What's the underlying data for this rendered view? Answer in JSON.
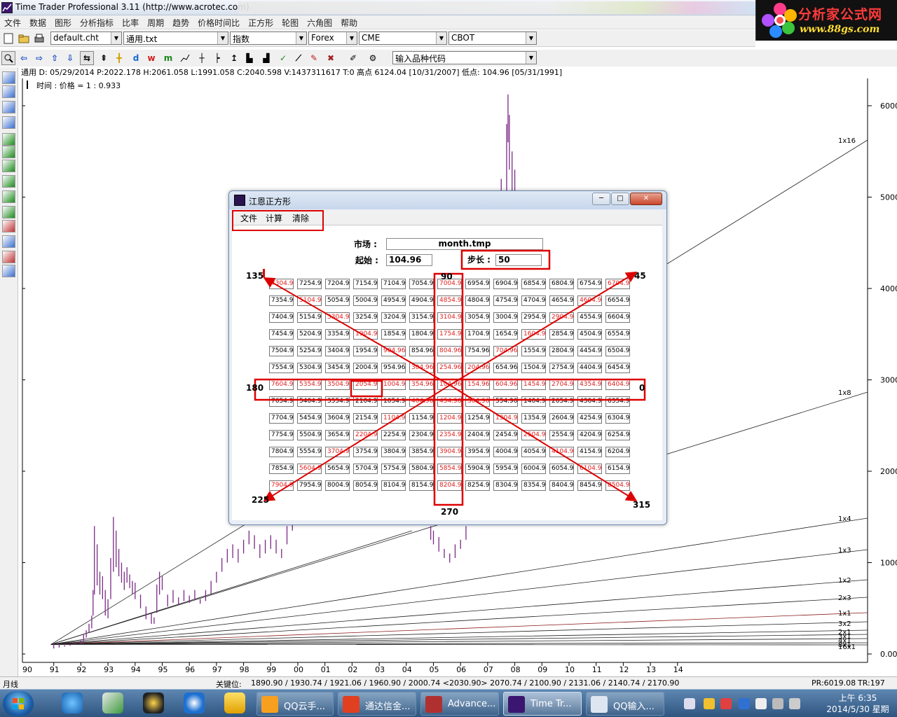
{
  "window": {
    "title": "Time Trader Professional 3.11 (http://www.acrotec.com)"
  },
  "brand": {
    "line1": "分析家公式网",
    "line2": "www.88gs.com"
  },
  "menu": [
    "文件",
    "数据",
    "图形",
    "分析指标",
    "比率",
    "周期",
    "趋势",
    "价格时间比",
    "正方形",
    "轮图",
    "六角图",
    "帮助"
  ],
  "toolbar": {
    "chart_file": "default.cht",
    "template_file": "通用.txt",
    "type": "指数",
    "market1": "Forex",
    "market2": "CME",
    "market3": "CBOT",
    "symbol_input": "输入品种代码"
  },
  "infobar": {
    "text": "通用  D: 05/29/2014  P:2022.178  H:2061.058  L:1991.058  C:2040.598  V:1437311617  T:0      高点   6124.04 [10/31/2007]  低点:    104.96 [05/31/1991]",
    "sub": "时间 : 价格  = 1 :    0.933"
  },
  "chart": {
    "y_ticks": [
      {
        "v": 6000,
        "label": "6000"
      },
      {
        "v": 5000,
        "label": "5000"
      },
      {
        "v": 4000,
        "label": "4000"
      },
      {
        "v": 3000,
        "label": "3000"
      },
      {
        "v": 2000,
        "label": "2000"
      },
      {
        "v": 1000,
        "label": "1000"
      },
      {
        "v": 0,
        "label": "0.00"
      }
    ],
    "x_ticks": [
      "91",
      "92",
      "93",
      "94",
      "95",
      "96",
      "97",
      "98",
      "99",
      "00",
      "01",
      "02",
      "03",
      "04",
      "05",
      "06",
      "07",
      "08",
      "09",
      "10",
      "11",
      "12",
      "13",
      "14"
    ],
    "x_start_label": "90",
    "fan_labels": [
      "1x16",
      "1x8",
      "1x4",
      "1x3",
      "1x2",
      "2x3",
      "1x1",
      "3x2",
      "2x1",
      "3x1",
      "4x1",
      "8x1",
      "16x1"
    ],
    "bars": [
      [
        1991.0,
        120,
        60
      ],
      [
        1991.2,
        110,
        70
      ],
      [
        1991.4,
        95,
        80
      ],
      [
        1991.6,
        110,
        90
      ],
      [
        1991.8,
        130,
        100
      ],
      [
        1992.0,
        150,
        110
      ],
      [
        1992.1,
        210,
        140
      ],
      [
        1992.2,
        260,
        180
      ],
      [
        1992.3,
        330,
        230
      ],
      [
        1992.4,
        420,
        280
      ],
      [
        1992.45,
        700,
        420
      ],
      [
        1992.5,
        1400,
        650
      ],
      [
        1992.6,
        1200,
        750
      ],
      [
        1992.7,
        900,
        650
      ],
      [
        1992.8,
        850,
        600
      ],
      [
        1992.9,
        700,
        420
      ],
      [
        1993.0,
        600,
        390
      ],
      [
        1993.1,
        1050,
        600
      ],
      [
        1993.2,
        1500,
        900
      ],
      [
        1993.3,
        1350,
        950
      ],
      [
        1993.4,
        1150,
        850
      ],
      [
        1993.5,
        1000,
        780
      ],
      [
        1993.6,
        900,
        700
      ],
      [
        1993.7,
        950,
        780
      ],
      [
        1993.8,
        870,
        720
      ],
      [
        1993.9,
        800,
        650
      ],
      [
        1994.0,
        780,
        600
      ],
      [
        1994.2,
        650,
        500
      ],
      [
        1994.4,
        520,
        380
      ],
      [
        1994.6,
        450,
        330
      ],
      [
        1994.7,
        400,
        330
      ],
      [
        1994.8,
        760,
        450
      ],
      [
        1994.9,
        900,
        650
      ],
      [
        1995.0,
        850,
        700
      ],
      [
        1995.2,
        650,
        520
      ],
      [
        1995.4,
        700,
        560
      ],
      [
        1995.6,
        620,
        540
      ],
      [
        1995.8,
        700,
        580
      ],
      [
        1996.0,
        640,
        560
      ],
      [
        1996.2,
        700,
        600
      ],
      [
        1996.4,
        600,
        550
      ],
      [
        1996.6,
        700,
        580
      ],
      [
        1996.8,
        800,
        650
      ],
      [
        1997.0,
        900,
        780
      ],
      [
        1997.2,
        1050,
        900
      ],
      [
        1997.4,
        1150,
        1000
      ],
      [
        1997.6,
        1200,
        1050
      ],
      [
        1997.8,
        1150,
        1000
      ],
      [
        1998.0,
        1250,
        1100
      ],
      [
        1998.2,
        1350,
        1200
      ],
      [
        1998.4,
        1300,
        1150
      ],
      [
        1998.6,
        1200,
        1050
      ],
      [
        1998.8,
        1250,
        1100
      ],
      [
        1999.0,
        1300,
        1150
      ],
      [
        1999.2,
        1250,
        1100
      ],
      [
        1999.4,
        1150,
        1050
      ],
      [
        1999.6,
        1400,
        1200
      ],
      [
        1999.8,
        1500,
        1350
      ],
      [
        2004.9,
        1400,
        1250
      ],
      [
        2005.0,
        1350,
        1200
      ],
      [
        2005.2,
        1280,
        1120
      ],
      [
        2005.4,
        1150,
        1050
      ],
      [
        2005.6,
        1100,
        1000
      ],
      [
        2005.8,
        1200,
        1050
      ],
      [
        2006.0,
        1250,
        1150
      ],
      [
        2006.2,
        1400,
        1250
      ],
      [
        2007.0,
        3800,
        3000
      ],
      [
        2007.2,
        4200,
        3500
      ],
      [
        2007.4,
        4600,
        4000
      ],
      [
        2007.5,
        5200,
        4400
      ],
      [
        2007.6,
        5000,
        4500
      ],
      [
        2007.7,
        5800,
        5000
      ],
      [
        2007.75,
        6124,
        5600
      ],
      [
        2007.8,
        5900,
        5300
      ],
      [
        2007.9,
        5500,
        4800
      ],
      [
        2008.0,
        5300,
        4500
      ]
    ]
  },
  "dialog": {
    "title": "江恩正方形",
    "menu": [
      "文件",
      "计算",
      "清除"
    ],
    "market_label": "市场 :",
    "market_value": "month.tmp",
    "start_label": "起始 :",
    "start_value": "104.96",
    "step_label": "步长 :",
    "step_value": "50",
    "angles": [
      "90",
      "45",
      "0",
      "315",
      "270",
      "225",
      "180",
      "135"
    ],
    "grid": [
      [
        "7304.96",
        "7254.96",
        "7204.96",
        "7154.96",
        "7104.96",
        "7054.96",
        "7004.96",
        "6954.96",
        "6904.96",
        "6854.96",
        "6804.96",
        "6754.96",
        "6704.96"
      ],
      [
        "7354.96",
        "5104.96",
        "5054.96",
        "5004.96",
        "4954.96",
        "4904.96",
        "4854.96",
        "4804.96",
        "4754.96",
        "4704.96",
        "4654.96",
        "4604.96",
        "6654.96"
      ],
      [
        "7404.96",
        "5154.96",
        "3304.96",
        "3254.96",
        "3204.96",
        "3154.96",
        "3104.96",
        "3054.96",
        "3004.96",
        "2954.96",
        "2904.96",
        "4554.96",
        "6604.96"
      ],
      [
        "7454.96",
        "5204.96",
        "3354.96",
        "1904.96",
        "1854.96",
        "1804.96",
        "1754.96",
        "1704.96",
        "1654.96",
        "1604.96",
        "2854.96",
        "4504.96",
        "6554.96"
      ],
      [
        "7504.96",
        "5254.96",
        "3404.96",
        "1954.96",
        "904.96",
        "854.96",
        "804.96",
        "754.96",
        "704.96",
        "1554.96",
        "2804.96",
        "4454.96",
        "6504.96"
      ],
      [
        "7554.96",
        "5304.96",
        "3454.96",
        "2004.96",
        "954.96",
        "304.96",
        "254.96",
        "204.96",
        "654.96",
        "1504.96",
        "2754.96",
        "4404.96",
        "6454.96"
      ],
      [
        "7604.96",
        "5354.96",
        "3504.96",
        "2054.96",
        "1004.96",
        "354.96",
        "104.96",
        "154.96",
        "604.96",
        "1454.96",
        "2704.96",
        "4354.96",
        "6404.96"
      ],
      [
        "7654.96",
        "5404.96",
        "3554.96",
        "2104.96",
        "1054.96",
        "404.96",
        "454.96",
        "504.96",
        "554.96",
        "1404.96",
        "2654.96",
        "4304.96",
        "6354.96"
      ],
      [
        "7704.96",
        "5454.96",
        "3604.96",
        "2154.96",
        "1104.96",
        "1154.96",
        "1204.96",
        "1254.96",
        "1304.96",
        "1354.96",
        "2604.96",
        "4254.96",
        "6304.96"
      ],
      [
        "7754.96",
        "5504.96",
        "3654.96",
        "2204.96",
        "2254.96",
        "2304.96",
        "2354.96",
        "2404.96",
        "2454.96",
        "2504.96",
        "2554.96",
        "4204.96",
        "6254.96"
      ],
      [
        "7804.96",
        "5554.96",
        "3704.96",
        "3754.96",
        "3804.96",
        "3854.96",
        "3904.96",
        "3954.96",
        "4004.96",
        "4054.96",
        "4104.96",
        "4154.96",
        "6204.96"
      ],
      [
        "7854.96",
        "5604.96",
        "5654.96",
        "5704.96",
        "5754.96",
        "5804.96",
        "5854.96",
        "5904.96",
        "5954.96",
        "6004.96",
        "6054.96",
        "6104.96",
        "6154.96"
      ],
      [
        "7904.96",
        "7954.96",
        "8004.96",
        "8054.96",
        "8104.96",
        "8154.96",
        "8204.96",
        "8254.96",
        "8304.96",
        "8354.96",
        "8404.96",
        "8454.96",
        "8504.96"
      ]
    ]
  },
  "statusbar": {
    "period": "月线",
    "key_label": "关键位:",
    "key_values": "1890.90 / 1930.74 / 1921.06 / 1960.90 / 2000.74 <2030.90> 2070.74 / 2100.90 / 2131.06 / 2140.74 / 2170.90",
    "pr": "PR:6019.08",
    "tr": "TR:197"
  },
  "taskbar": {
    "tasks": [
      "QQ云手...",
      "通达信金...",
      "Advance...",
      "Time Tr...",
      "QQ输入..."
    ],
    "time": "上午 6:35",
    "date": "2014/5/30 星期五"
  },
  "colors": {
    "price_bars": "#7b2a86",
    "highlight_red": "#e02020",
    "box_red": "#dd0000",
    "fan_line": "#222222",
    "dark_red_fan": "#8a1a1a"
  }
}
